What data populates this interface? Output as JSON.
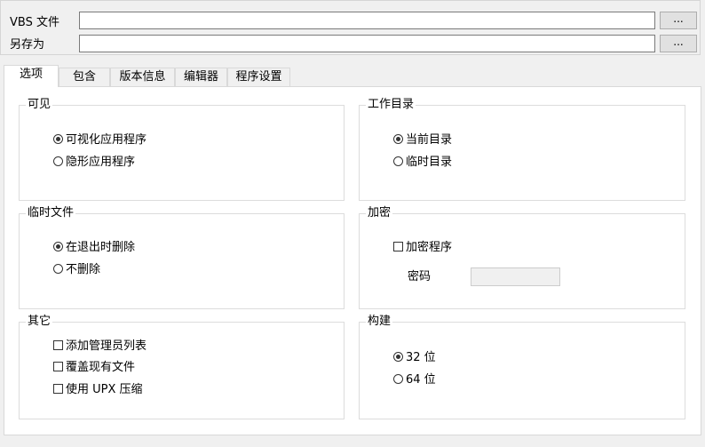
{
  "top": {
    "vbs_label": "VBS 文件",
    "vbs_value": "",
    "saveas_label": "另存为",
    "saveas_value": "",
    "browse_label": "..."
  },
  "tabs": [
    {
      "label": "选项",
      "active": true
    },
    {
      "label": "包含",
      "active": false
    },
    {
      "label": "版本信息",
      "active": false
    },
    {
      "label": "编辑器",
      "active": false
    },
    {
      "label": "程序设置",
      "active": false
    }
  ],
  "visible": {
    "title": "可见",
    "options": [
      {
        "label": "可视化应用程序",
        "selected": true
      },
      {
        "label": "隐形应用程序",
        "selected": false
      }
    ]
  },
  "workdir": {
    "title": "工作目录",
    "options": [
      {
        "label": "当前目录",
        "selected": true
      },
      {
        "label": "临时目录",
        "selected": false
      }
    ]
  },
  "tempfiles": {
    "title": "临时文件",
    "options": [
      {
        "label": "在退出时删除",
        "selected": true
      },
      {
        "label": "不删除",
        "selected": false
      }
    ]
  },
  "encrypt": {
    "title": "加密",
    "checkbox_label": "加密程序",
    "checked": false,
    "password_label": "密码",
    "password_value": ""
  },
  "other": {
    "title": "其它",
    "options": [
      {
        "label": "添加管理员列表",
        "checked": false
      },
      {
        "label": "覆盖现有文件",
        "checked": false
      },
      {
        "label": "使用 UPX 压缩",
        "checked": false
      }
    ]
  },
  "build": {
    "title": "构建",
    "options": [
      {
        "label": "32 位",
        "selected": true
      },
      {
        "label": "64 位",
        "selected": false
      }
    ]
  }
}
